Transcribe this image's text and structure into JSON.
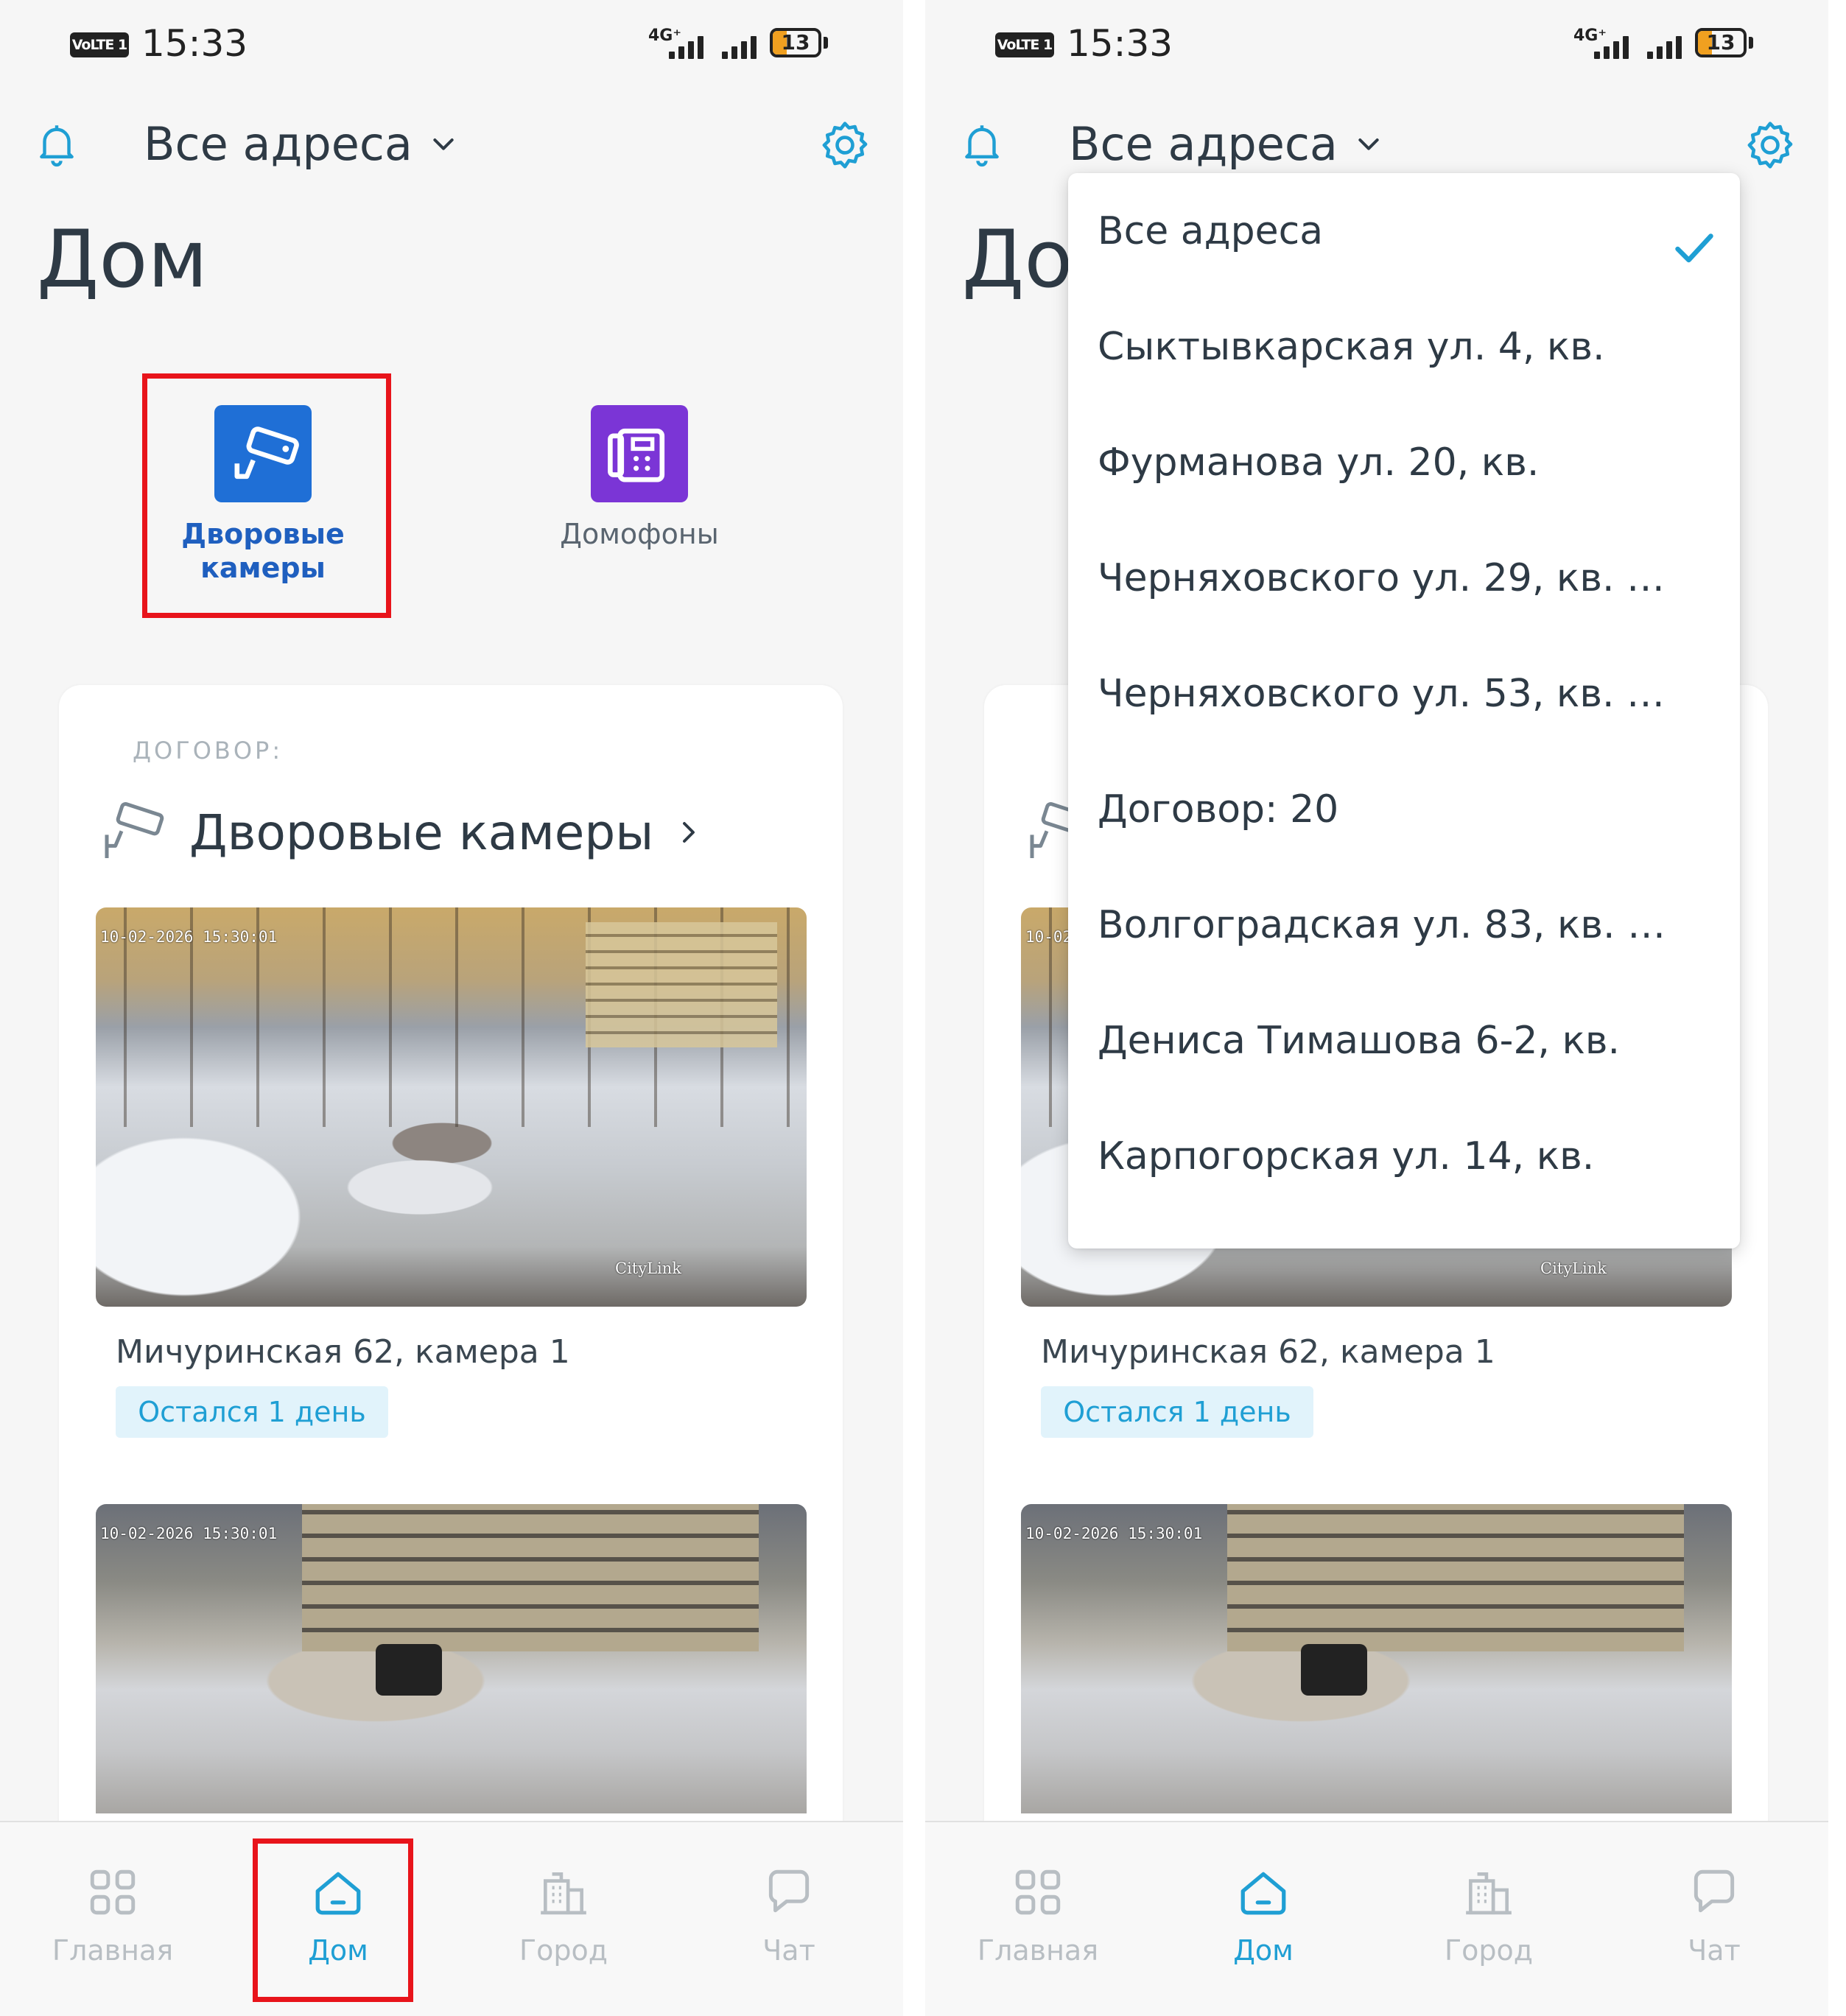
{
  "status_bar": {
    "volte": "VoLTE 1",
    "time": "15:33",
    "network": "4G⁺",
    "battery_level": "13"
  },
  "header": {
    "address_selector": "Все адреса"
  },
  "page_title": "Дом",
  "quick_tiles": {
    "cameras_label": "Дворовые камеры",
    "intercoms_label": "Домофоны"
  },
  "section": {
    "contract_label": "ДОГОВОР:",
    "title": "Дворовые камеры"
  },
  "cameras": [
    {
      "timestamp": "10-02-2026 15:30:01",
      "watermark": "CityLink",
      "name": "Мичуринская 62, камера 1",
      "badge": "Остался 1 день"
    },
    {
      "timestamp": "10-02-2026 15:30:01"
    }
  ],
  "nav": [
    {
      "label": "Главная",
      "icon": "grid-icon"
    },
    {
      "label": "Дом",
      "icon": "home-icon",
      "active": true
    },
    {
      "label": "Город",
      "icon": "city-icon"
    },
    {
      "label": "Чат",
      "icon": "chat-icon"
    }
  ],
  "dropdown": {
    "selected": "Все адреса",
    "items": [
      "Все адреса",
      "Сыктывкарская ул. 4, кв.",
      "Фурманова ул. 20, кв.",
      "Черняховского ул. 29, кв. …",
      "Черняховского ул. 53, кв. …",
      "Договор: 20",
      "Волгоградская ул. 83, кв. …",
      "Дениса Тимашова 6-2, кв.",
      "Карпогорская ул. 14, кв."
    ]
  },
  "colors": {
    "accent": "#1f9fd4",
    "cameras_tile": "#1f6fd6",
    "intercom_tile": "#7b35d6",
    "highlight": "#e8141b",
    "text_dark": "#2e3a45"
  }
}
